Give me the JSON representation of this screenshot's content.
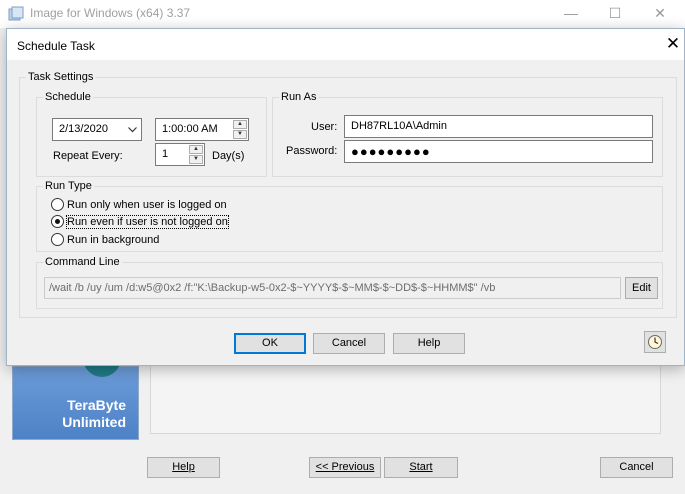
{
  "main_window": {
    "title": "Image for Windows (x64) 3.37",
    "logo_lines": [
      "TeraByte",
      "Unlimited"
    ],
    "buttons": {
      "help": "Help",
      "previous": "<< Previous",
      "start": "Start",
      "cancel": "Cancel"
    }
  },
  "dialog": {
    "title": "Schedule Task",
    "task_settings": {
      "label": "Task Settings",
      "schedule": {
        "label": "Schedule",
        "date": "2/13/2020",
        "time": "1:00:00 AM",
        "repeat_label": "Repeat Every:",
        "repeat_value": "1",
        "repeat_unit": "Day(s)"
      },
      "run_as": {
        "label": "Run As",
        "user_label": "User:",
        "user_value": "DH87RL10A\\Admin",
        "password_label": "Password:",
        "password_value": "●●●●●●●●●"
      },
      "run_type": {
        "label": "Run Type",
        "options": [
          "Run only when user is logged on",
          "Run even if user is not logged on",
          "Run in background"
        ],
        "selected_index": 1
      },
      "command_line": {
        "label": "Command Line",
        "value": "/wait /b /uy /um /d:w5@0x2 /f:\"K:\\Backup-w5-0x2-$~YYYY$-$~MM$-$~DD$-$~HHMM$\" /vb",
        "edit_label": "Edit"
      }
    },
    "buttons": {
      "ok": "OK",
      "cancel": "Cancel",
      "help": "Help"
    },
    "icons": {
      "schedule_history": "clock-icon",
      "close": "close-icon",
      "dropdown": "chevron-down-icon"
    }
  }
}
